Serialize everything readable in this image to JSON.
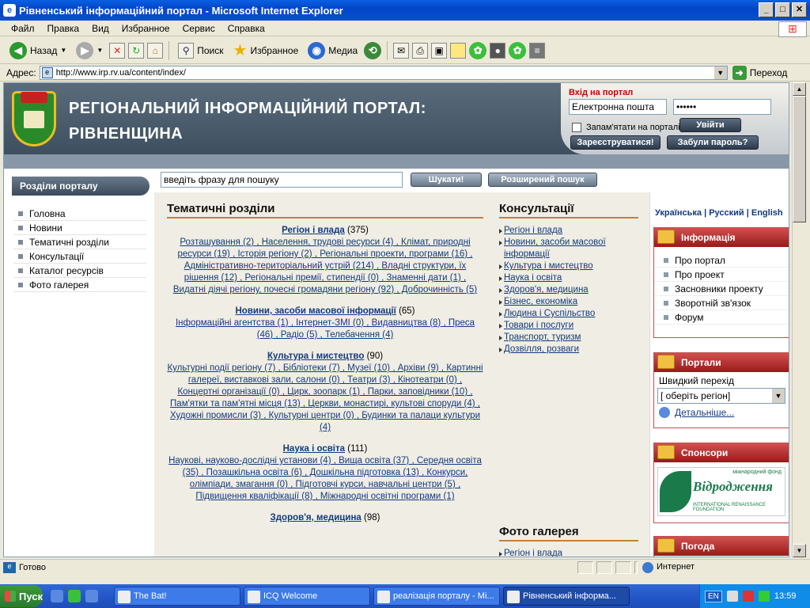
{
  "window": {
    "title": "Рівненський інформаційний портал - Microsoft Internet Explorer",
    "controls": [
      "_",
      "□",
      "✕"
    ]
  },
  "menu": [
    "Файл",
    "Правка",
    "Вид",
    "Избранное",
    "Сервис",
    "Справка"
  ],
  "toolbar": {
    "back": "Назад",
    "search": "Поиск",
    "favorites": "Избранное",
    "media": "Медиа"
  },
  "address": {
    "label": "Адрес:",
    "url": "http://www.irp.rv.ua/content/index/",
    "go": "Переход"
  },
  "portal": {
    "title_line1": "РЕГІОНАЛЬНИЙ ІНФОРМАЦІЙНИЙ ПОРТАЛ:",
    "title_line2": "РІВНЕНЩИНА",
    "login": {
      "heading": "Вхід на портал",
      "email_value": "Електронна пошта",
      "password_value": "••••••",
      "remember": "Запам'ятати на порталі",
      "login_btn": "Увійти",
      "register_btn": "Зареєструватися!",
      "forgot_btn": "Забули пароль?"
    },
    "search": {
      "value": "введіть фразу для пошуку",
      "search_btn": "Шукати!",
      "advanced_btn": "Розширений пошук"
    },
    "left": {
      "heading": "Розділи порталу",
      "items": [
        "Головна",
        "Новини",
        "Тематичні розділи",
        "Консультації",
        "Каталог ресурсів",
        "Фото галерея"
      ]
    },
    "thematic": {
      "heading": "Тематичні розділи",
      "sections": [
        {
          "title": "Регіон і влада",
          "count": "(375)",
          "body": "Розташування (2) , Населення, трудові ресурси (4) , Клімат, природні ресурси (19) , Історія регіону (2) , Регіональні проекти, програми (16) , Адміністративно-територіальний устрій (214) , Владні структури, їх рішення (12) , Регіональні премії, стипендії (0) , Знаменні дати (1) , Видатні діячі регіону, почесні громадяни регіону (92) , Доброчинність (5)"
        },
        {
          "title": "Новини, засоби масової інформації",
          "count": "(65)",
          "body": "Інформаційні агентства (1) , Інтернет-ЗМІ (0) , Видавництва (8) , Преса (46) , Радіо (5) , Телебачення (4)"
        },
        {
          "title": "Культура і мистецтво",
          "count": "(90)",
          "body": "Культурні події регіону (7) , Бібліотеки (7) , Музеї (10) , Архіви (9) , Картинні галереї, виставкові зали, салони (0) , Театри (3) , Кінотеатри (0) , Концертні організації (0) , Цирк, зоопарк (1) , Парки, заповідники (10) , Пам'ятки та пам'ятні місця (13) , Церкви, монастирі, культові споруди (4) , Художні промисли (3) , Культурні центри (0) , Будинки та палаци культури (4)"
        },
        {
          "title": "Наука і освіта",
          "count": "(111)",
          "body": "Наукові, науково-дослідні установи (4) , Вища освіта (37) , Середня освіта (35) , Позашкільна освіта (6) , Дошкільна підготовка (13) , Конкурси, олімпіади, змагання (0) , Підготовчі курси, навчальні центри (5) , Підвищення кваліфікації (8) , Міжнародні освітні програми (1)"
        },
        {
          "title": "Здоров'я, медицина",
          "count": "(98)",
          "body": ""
        }
      ]
    },
    "consult": {
      "heading": "Консультації",
      "items": [
        "Регіон і влада",
        "Новини, засоби масової інформації",
        "Культура і мистецтво",
        "Наука і освіта",
        "Здоров'я, медицина",
        "Бізнес, економіка",
        "Людина і Суспільство",
        "Товари і послуги",
        "Транспорт, туризм",
        "Дозвілля, розваги"
      ]
    },
    "photo": {
      "heading": "Фото галерея",
      "first_item": "Регіон і влада"
    },
    "right": {
      "langs": [
        "Українська",
        "Русский",
        "English"
      ],
      "info": {
        "heading": "Інформація",
        "items": [
          "Про портал",
          "Про проект",
          "Засновники проекту",
          "Зворотній зв'язок",
          "Форум"
        ]
      },
      "portals": {
        "heading": "Портали",
        "label": "Швидкий перехід",
        "select": "[ оберіть регіон]",
        "more": "Детальніше..."
      },
      "sponsors": {
        "heading": "Спонсори",
        "logo_text": "Відродження",
        "logo_sub": "INTERNATIONAL RENAISSANCE FOUNDATION",
        "logo_top": "міжнародний фонд"
      },
      "weather": {
        "heading": "Погода"
      }
    }
  },
  "status": {
    "left": "Готово",
    "zone": "Интернет"
  },
  "taskbar": {
    "start": "Пуск",
    "tasks": [
      "The Bat!",
      "ICQ Welcome",
      "реалізація  порталу - Mi...",
      "Рівненський інформа..."
    ],
    "lang": "EN",
    "time": "13:59"
  },
  "colors": {
    "header": "#4a5c6c",
    "accent_red": "#b02020",
    "link": "#113a80"
  }
}
